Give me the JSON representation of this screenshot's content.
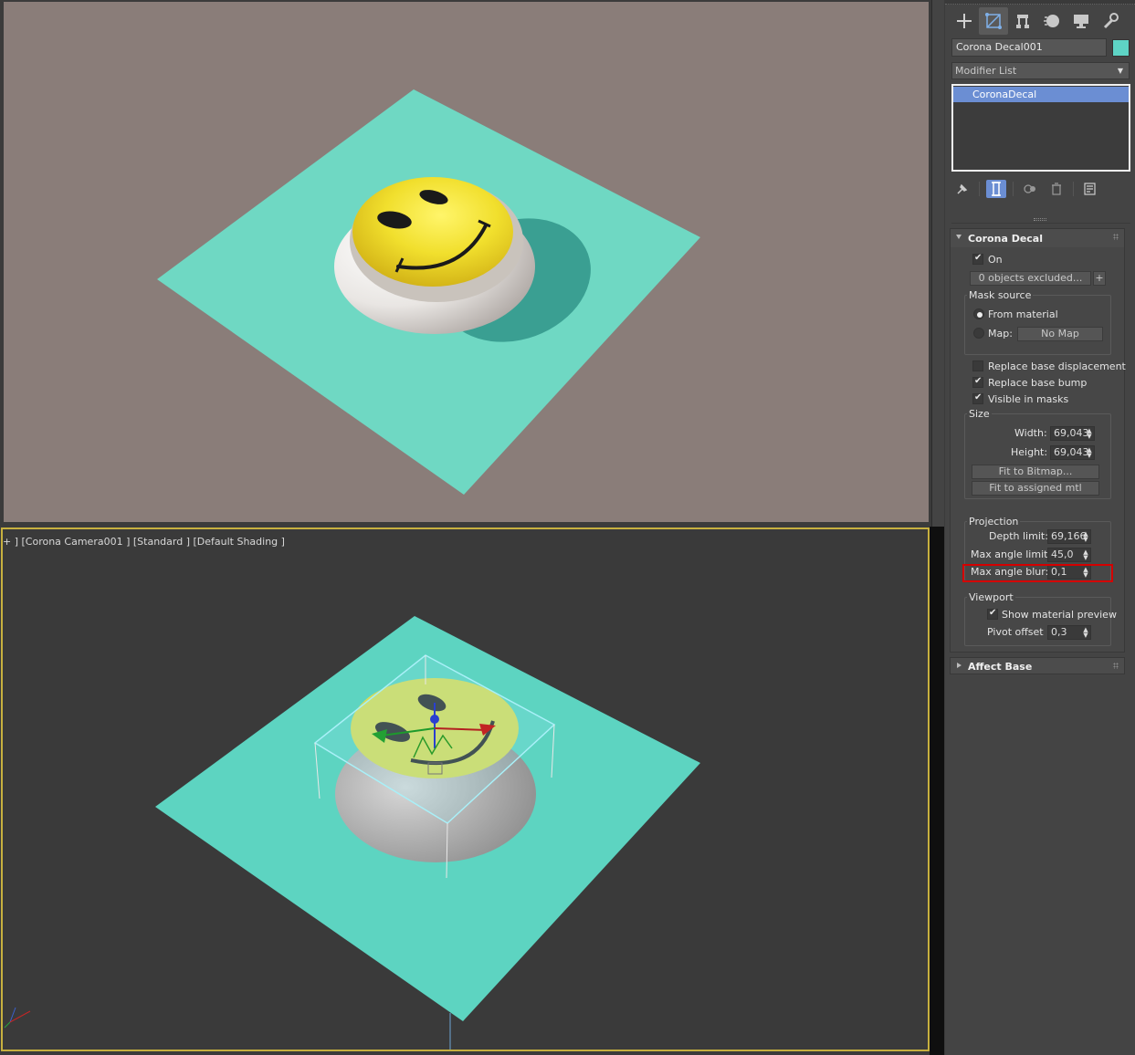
{
  "viewport": {
    "camera_label": "+ ] [Corona Camera001 ] [Standard ] [Default Shading ]",
    "render_bg": "#8a7d79",
    "plane_color": "#6ed6c4"
  },
  "command_panel": {
    "tabs": [
      "create-icon",
      "modify-icon",
      "hierarchy-icon",
      "motion-icon",
      "display-icon",
      "utilities-icon"
    ],
    "object_name": "Corona Decal001",
    "object_color": "#5ed4c5",
    "modifier_list_label": "Modifier List",
    "stack_items": [
      "CoronaDecal"
    ]
  },
  "corona_decal": {
    "title": "Corona Decal",
    "on_label": "On",
    "on_checked": true,
    "excluded_button": "0 objects excluded...",
    "add_button": "+",
    "mask_source": {
      "title": "Mask source",
      "from_material": "From material",
      "map_label": "Map:",
      "map_button": "No Map",
      "selected": "From material"
    },
    "replace_base_displacement": {
      "label": "Replace base displacement",
      "checked": false
    },
    "replace_base_bump": {
      "label": "Replace base bump",
      "checked": true
    },
    "visible_in_masks": {
      "label": "Visible in masks",
      "checked": true
    },
    "size": {
      "title": "Size",
      "width_label": "Width:",
      "width_value": "69,043",
      "height_label": "Height:",
      "height_value": "69,043",
      "fit_bitmap": "Fit to Bitmap...",
      "fit_mtl": "Fit to assigned mtl"
    },
    "projection": {
      "title": "Projection",
      "depth_label": "Depth limit:",
      "depth_value": "69,166",
      "max_angle_label": "Max angle limit:",
      "max_angle_value": "45,0",
      "blur_label": "Max angle blur:",
      "blur_value": "0,1"
    },
    "viewport": {
      "title": "Viewport",
      "show_preview": {
        "label": "Show material preview",
        "checked": true
      },
      "pivot_label": "Pivot offset",
      "pivot_value": "0,3"
    }
  },
  "affect_base": {
    "title": "Affect Base"
  }
}
